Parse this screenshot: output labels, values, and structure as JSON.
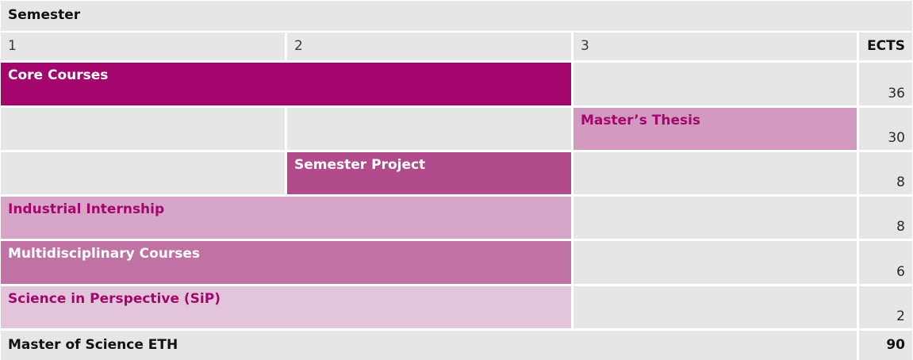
{
  "header": {
    "title": "Semester",
    "semesters": [
      "1",
      "2",
      "3"
    ],
    "ects_label": "ECTS"
  },
  "rows": [
    {
      "label": "Core Courses",
      "ects": "36"
    },
    {
      "label": "Master’s Thesis",
      "ects": "30"
    },
    {
      "label": "Semester Project",
      "ects": "8"
    },
    {
      "label": "Industrial Internship",
      "ects": "8"
    },
    {
      "label": "Multidisciplinary Courses",
      "ects": "6"
    },
    {
      "label": "Science in Perspective (SiP)",
      "ects": "2"
    }
  ],
  "total": {
    "label": "Master of Science ETH",
    "ects": "90"
  },
  "colors": {
    "background": "#e6e6e6",
    "core": "#a4066e",
    "thesis": "#d39ac0",
    "project": "#b24b8b",
    "internship": "#d6a5c7",
    "multidisciplinary": "#c072a4",
    "sip": "#e2c5da",
    "magenta_text": "#a4066e"
  }
}
